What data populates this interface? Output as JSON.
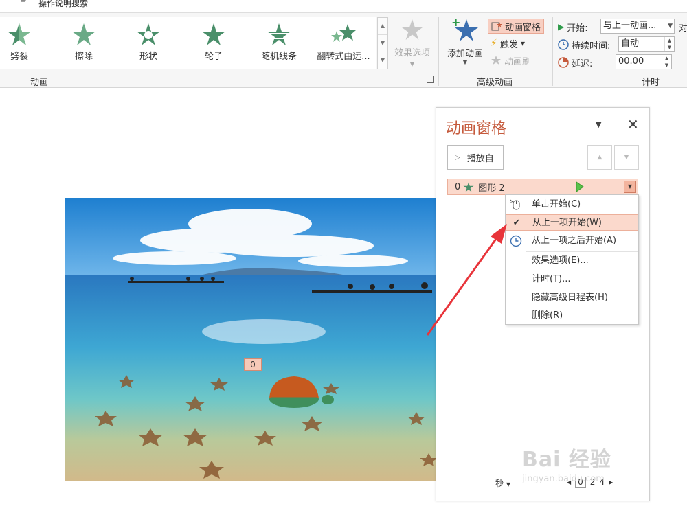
{
  "search": {
    "text": "操作说明搜索"
  },
  "ribbon": {
    "effects": [
      {
        "label": "劈裂",
        "icon": "split-star-icon"
      },
      {
        "label": "擦除",
        "icon": "wipe-star-icon"
      },
      {
        "label": "形状",
        "icon": "shape-star-icon"
      },
      {
        "label": "轮子",
        "icon": "wheel-star-icon"
      },
      {
        "label": "随机线条",
        "icon": "random-bars-star-icon"
      },
      {
        "label": "翻转式由远...",
        "icon": "grow-turn-star-icon"
      }
    ],
    "effect_options": "效果选项",
    "group_animation": "动画",
    "add_animation": "添加动画",
    "animation_pane": "动画窗格",
    "trigger": "触发",
    "animation_painter": "动画刷",
    "group_advanced": "高级动画",
    "start_label": "开始:",
    "start_value": "与上一动画...",
    "duration_label": "持续时间:",
    "duration_value": "自动",
    "delay_label": "延迟:",
    "delay_value": "00.00",
    "group_timing": "计时",
    "cut_off": "对"
  },
  "slide": {
    "tag": "0"
  },
  "pane": {
    "title": "动画窗格",
    "play_from": "播放自",
    "item_number": "0",
    "item_name": "图形 2",
    "seconds": "秒",
    "timeline": [
      "0",
      "2",
      "4"
    ]
  },
  "menu": {
    "items": [
      {
        "label": "单击开始(C)",
        "icon": "mouse-click-icon"
      },
      {
        "label": "从上一项开始(W)",
        "icon": "checkmark-icon"
      },
      {
        "label": "从上一项之后开始(A)",
        "icon": "clock-icon"
      },
      {
        "label": "效果选项(E)..."
      },
      {
        "label": "计时(T)..."
      },
      {
        "label": "隐藏高级日程表(H)"
      },
      {
        "label": "删除(R)"
      }
    ]
  },
  "watermark": {
    "big": "Bai 经验",
    "small": "jingyan.baidu.com"
  },
  "colors": {
    "accent": "#c55a3c",
    "star_green": "#4a8f6a",
    "selection": "#fbd9cc",
    "arrow": "#e8343a"
  }
}
